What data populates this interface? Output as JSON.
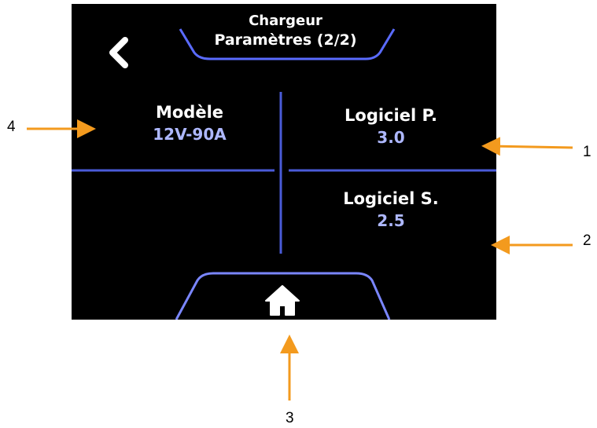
{
  "header": {
    "title_line1": "Chargeur",
    "title_line2": "Paramètres (2/2)"
  },
  "cells": {
    "model": {
      "label": "Modèle",
      "value": "12V-90A"
    },
    "software_p": {
      "label": "Logiciel P.",
      "value": "3.0"
    },
    "software_s": {
      "label": "Logiciel S.",
      "value": "2.5"
    }
  },
  "icons": {
    "back": "chevron-left-icon",
    "home": "home-icon"
  },
  "annotations": {
    "n1": "1",
    "n2": "2",
    "n3": "3",
    "n4": "4"
  },
  "colors": {
    "screen_bg": "#000000",
    "accent_blue": "#4a5bd8",
    "value_blue": "#aeb8ff",
    "arrow_orange": "#f39a1e"
  }
}
